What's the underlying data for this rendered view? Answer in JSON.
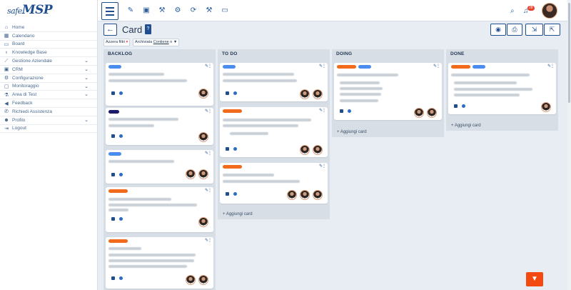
{
  "app": {
    "logo_prefix": "safe",
    "logo_main": "MSP"
  },
  "sidebar": {
    "items": [
      {
        "label": "Home",
        "icon": "home-icon",
        "chevron": false
      },
      {
        "label": "Calendario",
        "icon": "calendar-icon",
        "chevron": false
      },
      {
        "label": "Board",
        "icon": "board-icon",
        "chevron": false
      },
      {
        "label": "Knowledge Base",
        "icon": "bulb-icon",
        "chevron": false
      },
      {
        "label": "Gestione Aziendale",
        "icon": "chart-icon",
        "chevron": true
      },
      {
        "label": "CRM",
        "icon": "id-card-icon",
        "chevron": true
      },
      {
        "label": "Configurazione",
        "icon": "cogs-icon",
        "chevron": true
      },
      {
        "label": "Monitoraggio",
        "icon": "monitor-icon",
        "chevron": true
      },
      {
        "label": "Area di Test",
        "icon": "flask-icon",
        "chevron": true
      },
      {
        "label": "Feedback",
        "icon": "megaphone-icon",
        "chevron": false
      },
      {
        "label": "Richiedi Assistenza",
        "icon": "phone-icon",
        "chevron": false
      },
      {
        "label": "Profilo",
        "icon": "user-cog-icon",
        "chevron": true
      },
      {
        "label": "Logout",
        "icon": "logout-icon",
        "chevron": false
      }
    ]
  },
  "topbar": {
    "icons": [
      "pencil-icon",
      "id-card-icon",
      "tools-icon",
      "gear-hand-icon",
      "sync-icon",
      "tools-icon",
      "laptop-icon"
    ],
    "notification_count": "28"
  },
  "page": {
    "title": "Card",
    "actions": [
      "camera-icon",
      "print-icon",
      "file-import-icon",
      "file-export-icon"
    ]
  },
  "filters": {
    "reset_label": "Azzera filtri",
    "archived_label": "Archiviata",
    "archived_operator": "Contiene",
    "archived_value": "n"
  },
  "columns": [
    {
      "title": "BACKLOG",
      "add_label": ""
    },
    {
      "title": "TO DO",
      "add_label": "Aggiungi card"
    },
    {
      "title": "DOING",
      "add_label": "Aggiungi card"
    },
    {
      "title": "DONE",
      "add_label": "Aggiungi card"
    }
  ],
  "colors": {
    "accent": "#1f4f8f",
    "tag_blue": "#4a8df0",
    "tag_navy": "#1c1a6a",
    "tag_orange": "#f26a1b",
    "fab": "#f24a10"
  }
}
